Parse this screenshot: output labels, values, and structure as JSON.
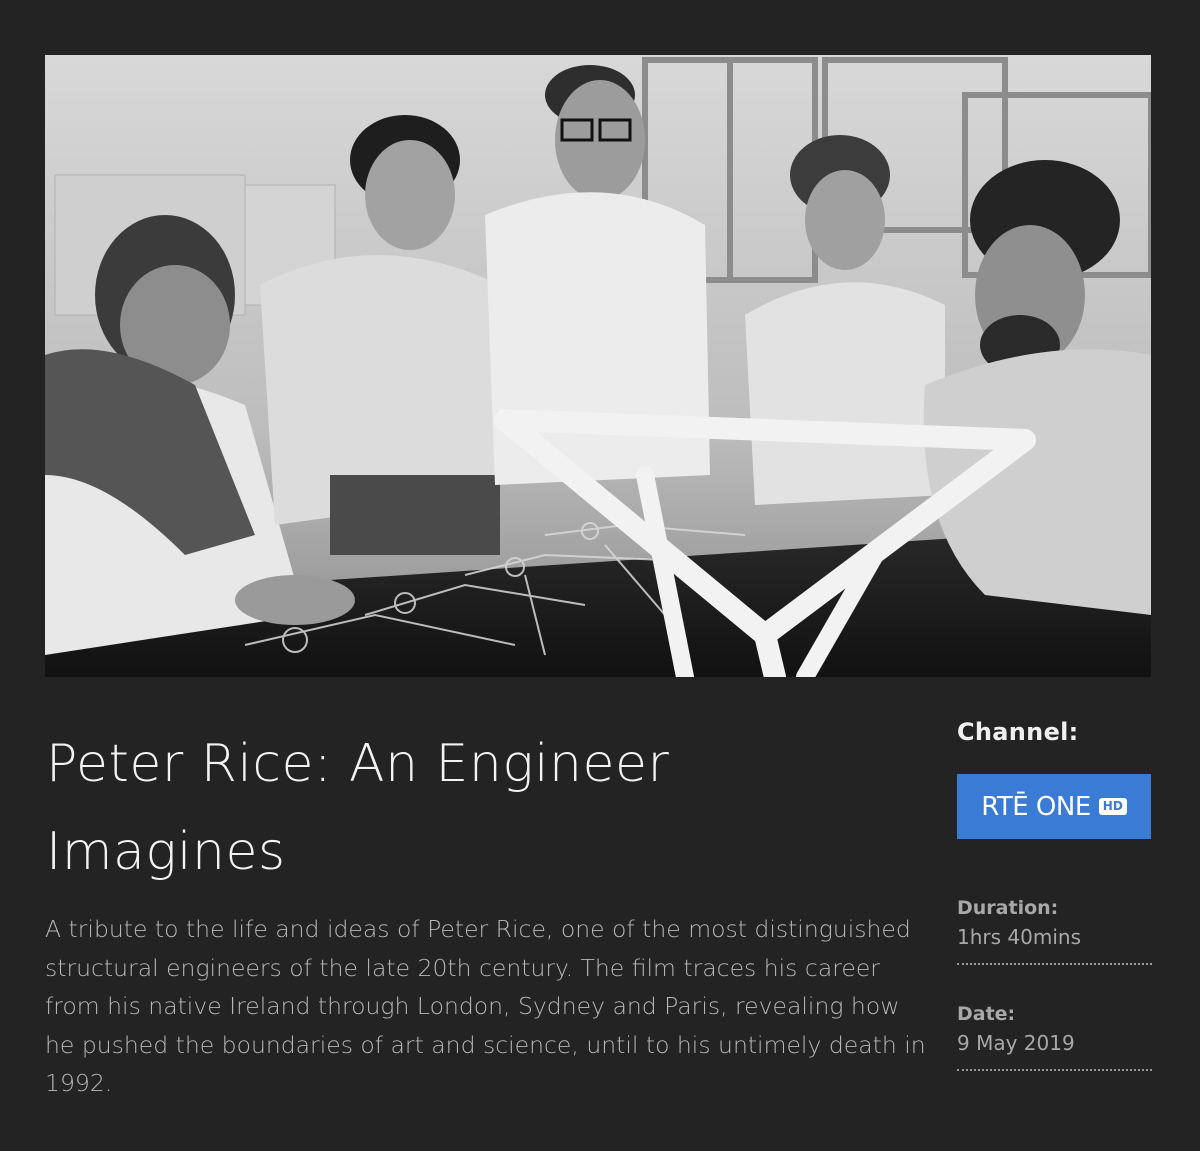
{
  "hero": {
    "image_description_icon": "photo-icon"
  },
  "programme": {
    "title": "Peter Rice: An Engineer Imagines",
    "description": "A tribute to the life and ideas of Peter Rice, one of the most distinguished structural engineers of the late 20th century. The film traces his career from his native Ireland through London, Sydney and Paris, revealing how he pushed the boundaries of art and science, until to his untimely death in 1992."
  },
  "meta": {
    "channel_label": "Channel:",
    "channel_logo_text": "RTĒ ONE",
    "channel_logo_badge": "HD",
    "channel_color": "#3a7bd5",
    "duration_label": "Duration:",
    "duration_value": "1hrs 40mins",
    "date_label": "Date:",
    "date_value": "9 May 2019"
  }
}
